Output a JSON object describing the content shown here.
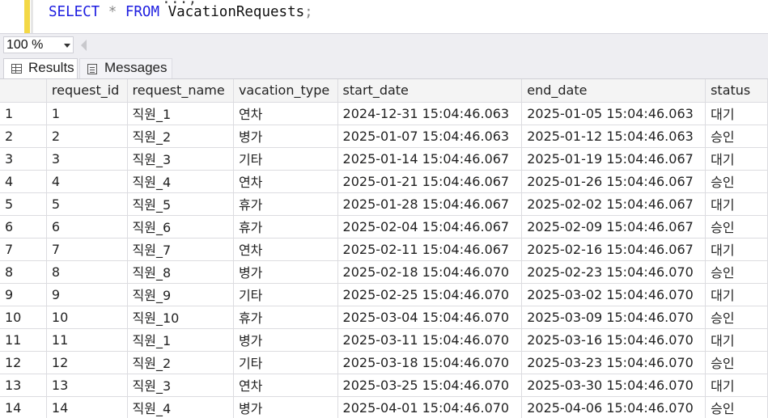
{
  "editor": {
    "line_prev": "...;",
    "query": {
      "kw_select": "SELECT",
      "star": "*",
      "kw_from": "FROM",
      "table": "VacationRequests",
      "semicolon": ";"
    }
  },
  "zoom": {
    "value": "100 %"
  },
  "tabs": [
    {
      "label": "Results",
      "icon": "grid-icon",
      "active": true
    },
    {
      "label": "Messages",
      "icon": "messages-icon",
      "active": false
    }
  ],
  "grid": {
    "columns": [
      "",
      "request_id",
      "request_name",
      "vacation_type",
      "start_date",
      "end_date",
      "status"
    ],
    "rows": [
      [
        "1",
        "1",
        "직원_1",
        "연차",
        "2024-12-31 15:04:46.063",
        "2025-01-05 15:04:46.063",
        "대기"
      ],
      [
        "2",
        "2",
        "직원_2",
        "병가",
        "2025-01-07 15:04:46.063",
        "2025-01-12 15:04:46.063",
        "승인"
      ],
      [
        "3",
        "3",
        "직원_3",
        "기타",
        "2025-01-14 15:04:46.067",
        "2025-01-19 15:04:46.067",
        "대기"
      ],
      [
        "4",
        "4",
        "직원_4",
        "연차",
        "2025-01-21 15:04:46.067",
        "2025-01-26 15:04:46.067",
        "승인"
      ],
      [
        "5",
        "5",
        "직원_5",
        "휴가",
        "2025-01-28 15:04:46.067",
        "2025-02-02 15:04:46.067",
        "대기"
      ],
      [
        "6",
        "6",
        "직원_6",
        "휴가",
        "2025-02-04 15:04:46.067",
        "2025-02-09 15:04:46.067",
        "승인"
      ],
      [
        "7",
        "7",
        "직원_7",
        "연차",
        "2025-02-11 15:04:46.067",
        "2025-02-16 15:04:46.067",
        "대기"
      ],
      [
        "8",
        "8",
        "직원_8",
        "병가",
        "2025-02-18 15:04:46.070",
        "2025-02-23 15:04:46.070",
        "승인"
      ],
      [
        "9",
        "9",
        "직원_9",
        "기타",
        "2025-02-25 15:04:46.070",
        "2025-03-02 15:04:46.070",
        "대기"
      ],
      [
        "10",
        "10",
        "직원_10",
        "휴가",
        "2025-03-04 15:04:46.070",
        "2025-03-09 15:04:46.070",
        "승인"
      ],
      [
        "11",
        "11",
        "직원_1",
        "병가",
        "2025-03-11 15:04:46.070",
        "2025-03-16 15:04:46.070",
        "대기"
      ],
      [
        "12",
        "12",
        "직원_2",
        "기타",
        "2025-03-18 15:04:46.070",
        "2025-03-23 15:04:46.070",
        "승인"
      ],
      [
        "13",
        "13",
        "직원_3",
        "연차",
        "2025-03-25 15:04:46.070",
        "2025-03-30 15:04:46.070",
        "대기"
      ],
      [
        "14",
        "14",
        "직원_4",
        "병가",
        "2025-04-01 15:04:46.070",
        "2025-04-06 15:04:46.070",
        "승인"
      ]
    ]
  }
}
